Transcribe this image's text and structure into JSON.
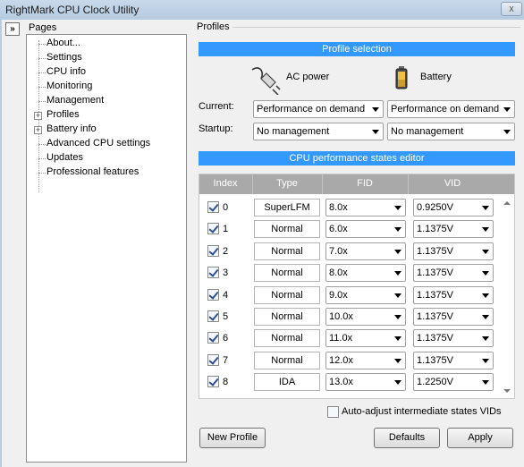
{
  "window": {
    "title": "RightMark CPU Clock Utility",
    "close_glyph": "x"
  },
  "pages": {
    "label": "Pages",
    "collapse_glyph": "»",
    "items": [
      {
        "label": "About..."
      },
      {
        "label": "Settings"
      },
      {
        "label": "CPU info"
      },
      {
        "label": "Monitoring"
      },
      {
        "label": "Management"
      },
      {
        "label": "Profiles",
        "expander": "+"
      },
      {
        "label": "Battery info",
        "expander": "+"
      },
      {
        "label": "Advanced CPU settings"
      },
      {
        "label": "Updates"
      },
      {
        "label": "Professional features"
      }
    ]
  },
  "profiles": {
    "group_label": "Profiles",
    "selection_header": "Profile selection",
    "ac_label": "AC power",
    "battery_label": "Battery",
    "current_label": "Current:",
    "startup_label": "Startup:",
    "current_ac": "Performance on demand",
    "current_battery": "Performance on demand",
    "startup_ac": "No management",
    "startup_battery": "No management",
    "editor_header": "CPU performance states editor"
  },
  "editor": {
    "columns": [
      "Index",
      "Type",
      "FID",
      "VID"
    ],
    "rows": [
      {
        "checked": true,
        "index": "0",
        "type": "SuperLFM",
        "fid": "8.0x",
        "vid": "0.9250V"
      },
      {
        "checked": true,
        "index": "1",
        "type": "Normal",
        "fid": "6.0x",
        "vid": "1.1375V"
      },
      {
        "checked": true,
        "index": "2",
        "type": "Normal",
        "fid": "7.0x",
        "vid": "1.1375V"
      },
      {
        "checked": true,
        "index": "3",
        "type": "Normal",
        "fid": "8.0x",
        "vid": "1.1375V"
      },
      {
        "checked": true,
        "index": "4",
        "type": "Normal",
        "fid": "9.0x",
        "vid": "1.1375V"
      },
      {
        "checked": true,
        "index": "5",
        "type": "Normal",
        "fid": "10.0x",
        "vid": "1.1375V"
      },
      {
        "checked": true,
        "index": "6",
        "type": "Normal",
        "fid": "11.0x",
        "vid": "1.1375V"
      },
      {
        "checked": true,
        "index": "7",
        "type": "Normal",
        "fid": "12.0x",
        "vid": "1.1375V"
      },
      {
        "checked": true,
        "index": "8",
        "type": "IDA",
        "fid": "13.0x",
        "vid": "1.2250V"
      }
    ],
    "auto_adjust_label": "Auto-adjust intermediate states VIDs",
    "auto_adjust_checked": false
  },
  "buttons": {
    "new_profile": "New Profile",
    "defaults": "Defaults",
    "apply": "Apply"
  },
  "icons": {
    "ac": "power-plug-icon",
    "battery": "battery-icon"
  },
  "colors": {
    "section_bar": "#3399ff",
    "grid_header": "#a9a9a9"
  }
}
